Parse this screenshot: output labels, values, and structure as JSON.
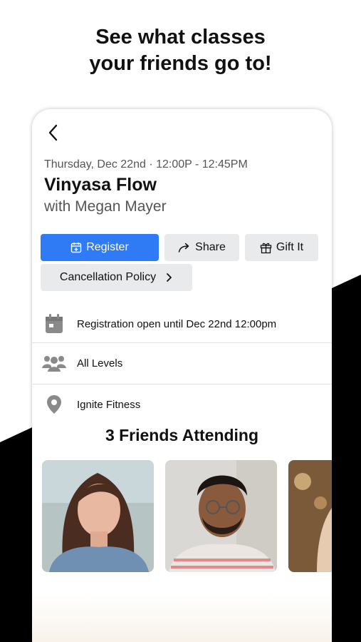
{
  "headline": {
    "line1": "See what classes",
    "line2": "your friends go to!"
  },
  "header": {
    "back_icon": "chevron-left-icon"
  },
  "class": {
    "datetime": "Thursday, Dec 22nd · 12:00P - 12:45PM",
    "title": "Vinyasa Flow",
    "instructor": "with Megan Mayer"
  },
  "actions": {
    "register_label": "Register",
    "share_label": "Share",
    "gift_label": "Gift It",
    "policy_label": "Cancellation Policy"
  },
  "info": {
    "registration": "Registration open until Dec 22nd 12:00pm",
    "level": "All Levels",
    "location": "Ignite Fitness"
  },
  "friends": {
    "title": "3 Friends Attending"
  },
  "colors": {
    "primary": "#2f7bf5",
    "secondary_button": "#e9eaec",
    "icon_gray": "#8a8a8a"
  }
}
